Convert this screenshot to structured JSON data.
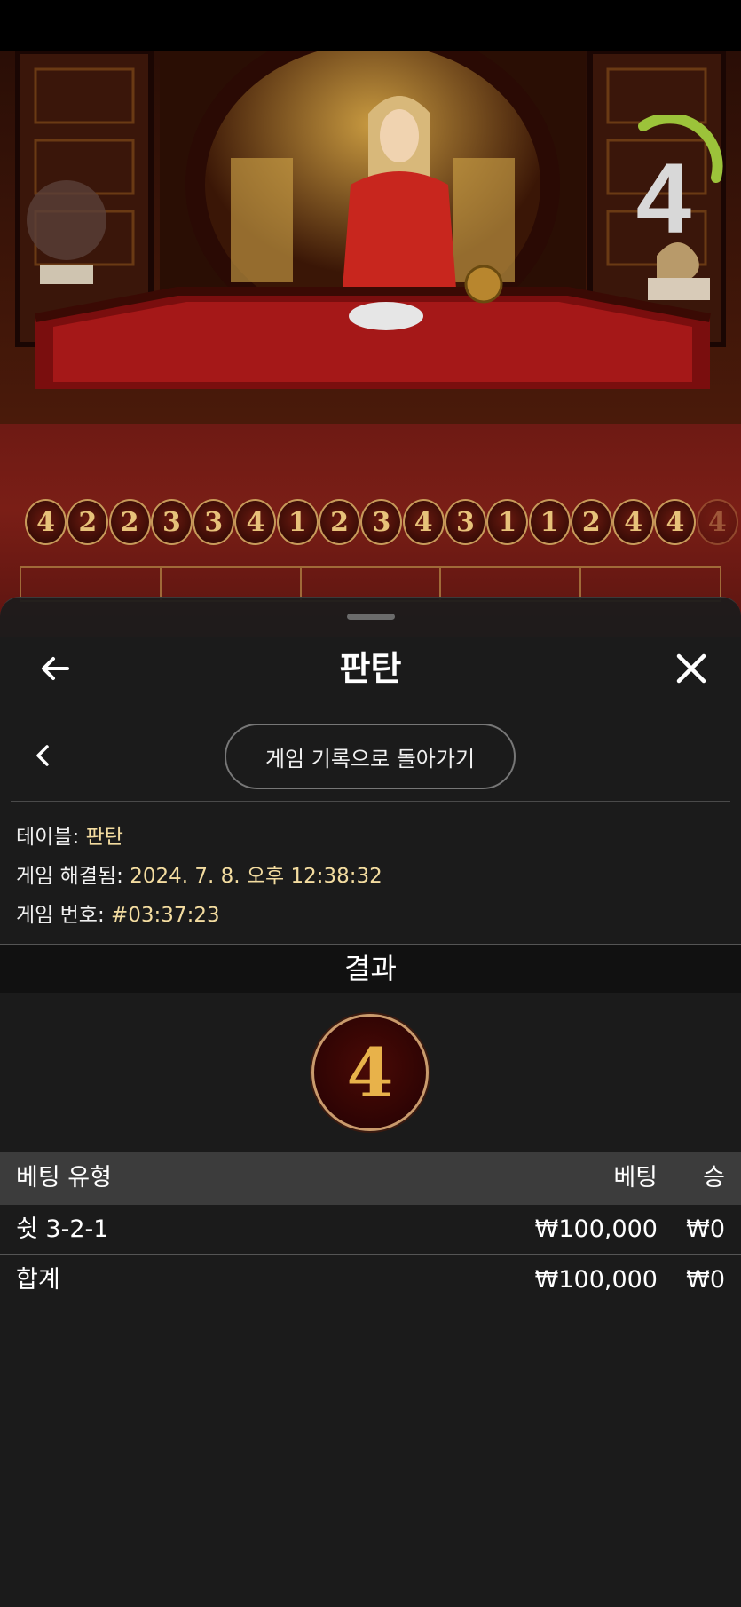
{
  "game": {
    "countdown": "4",
    "history": [
      "4",
      "2",
      "2",
      "3",
      "3",
      "4",
      "1",
      "2",
      "3",
      "4",
      "3",
      "1",
      "1",
      "2",
      "4",
      "4",
      "4"
    ]
  },
  "sheet": {
    "title": "판탄",
    "history_button": "게임 기록으로 돌아가기",
    "info": {
      "table_label": "테이블:",
      "table_value": "판탄",
      "resolved_label": "게임 해결됨:",
      "resolved_value": "2024. 7. 8. 오후 12:38:32",
      "number_label": "게임 번호:",
      "number_value": "#03:37:23"
    },
    "result_header": "결과",
    "result_value": "4",
    "bets_table": {
      "headers": [
        "베팅 유형",
        "베팅",
        "승"
      ],
      "rows": [
        {
          "type": "쉿 3-2-1",
          "bet": "₩100,000",
          "win": "₩0"
        }
      ],
      "total": {
        "label": "합계",
        "bet": "₩100,000",
        "win": "₩0"
      }
    }
  },
  "colors": {
    "accent_gold": "#f3dca0",
    "ball_gold": "#e8b24a",
    "sheet_bg": "#1c1c1c"
  },
  "icons": [
    "back-arrow-icon",
    "close-icon",
    "chevron-left-icon"
  ]
}
